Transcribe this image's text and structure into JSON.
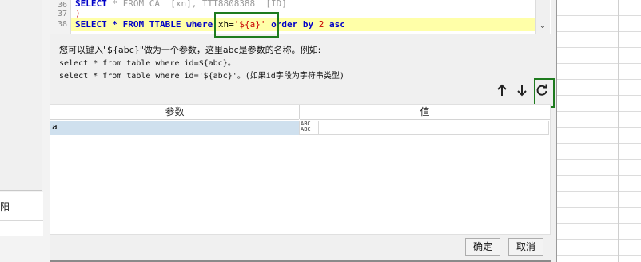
{
  "left_panel": {
    "label": "阳"
  },
  "editor": {
    "line_numbers": [
      "36",
      "37",
      "38"
    ],
    "line36": {
      "kw": "SELECT",
      "rest": " * FROM CA  [xn], TTT8808388  [ID]"
    },
    "line37": ")",
    "line38": {
      "select": "SELECT",
      "star_from": " * FROM TTABLE ",
      "where": "where",
      "cond_field": " xh=",
      "cond_value": "'${a}'",
      "order_by": " order by ",
      "num": "2",
      "asc": " asc"
    }
  },
  "help": {
    "line1": "您可以键入\"${abc}\"做为一个参数，这里abc是参数的名称。例如:",
    "line2": "select * from table where id=${abc}。",
    "line3": "select * from table where id='${abc}'。(如果id字段为字符串类型)"
  },
  "toolbar": {
    "up_icon": "arrow-up-icon",
    "down_icon": "arrow-down-icon",
    "refresh_icon": "refresh-icon"
  },
  "params_table": {
    "headers": {
      "param": "参数",
      "value": "值"
    },
    "rows": [
      {
        "param": "a",
        "type_top": "ABC",
        "type_bottom": "ABC",
        "value": ""
      }
    ]
  },
  "buttons": {
    "ok": "确定",
    "cancel": "取消"
  },
  "colors": {
    "highlight_green": "#1e7b1e",
    "current_line": "#ffffa8",
    "selected_row": "#cfe0ee"
  }
}
